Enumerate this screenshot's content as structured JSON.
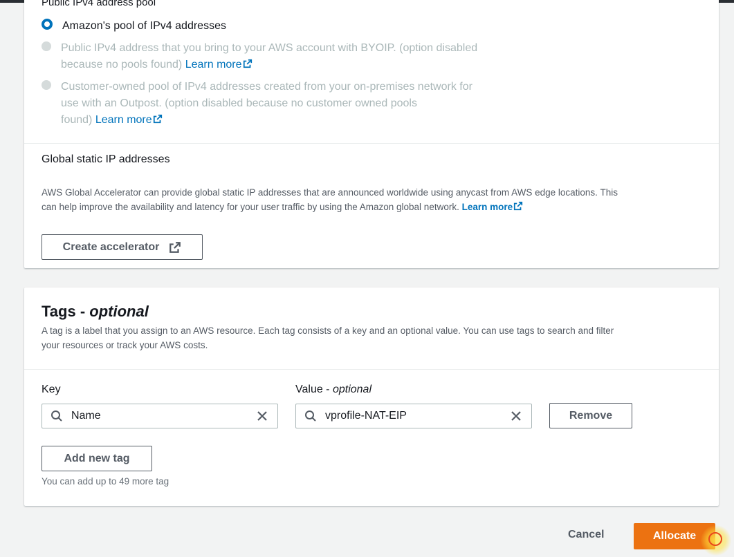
{
  "ip_pool": {
    "heading": "Public IPv4 address pool",
    "options": [
      {
        "label": "Amazon's pool of IPv4 addresses",
        "selected": true
      },
      {
        "label_line1": "Public IPv4 address that you bring to your AWS account with BYOIP. (option disabled",
        "label_line2": "because no pools found)",
        "link": "Learn more",
        "disabled": true
      },
      {
        "label_line1": "Customer-owned pool of IPv4 addresses created from your on-premises network for",
        "label_line2": "use with an Outpost. (option disabled because no customer owned pools",
        "label_line3": "found)",
        "link": "Learn more",
        "disabled": true
      }
    ]
  },
  "global_ip": {
    "title": "Global static IP addresses",
    "description_line1": "AWS Global Accelerator can provide global static IP addresses that are announced worldwide using anycast from AWS edge locations. This",
    "description_line2": "can help improve the availability and latency for your user traffic by using the Amazon global network.",
    "link": "Learn more",
    "button": "Create accelerator"
  },
  "tags": {
    "title": "Tags - ",
    "title_suffix": "optional",
    "description_line1": "A tag is a label that you assign to an AWS resource. Each tag consists of a key and an optional value. You can use tags to search and filter",
    "description_line2": "your resources or track your AWS costs.",
    "key_label": "Key",
    "value_label": "Value - ",
    "value_label_suffix": "optional",
    "key_value": "Name",
    "value_value": "vprofile-NAT-EIP",
    "remove_button": "Remove",
    "add_button": "Add new tag",
    "hint": "You can add up to 49 more tag"
  },
  "footer": {
    "cancel": "Cancel",
    "allocate": "Allocate"
  },
  "colors": {
    "primary": "#ec7211",
    "link": "#0073bb",
    "disabled": "#aab7b8"
  }
}
